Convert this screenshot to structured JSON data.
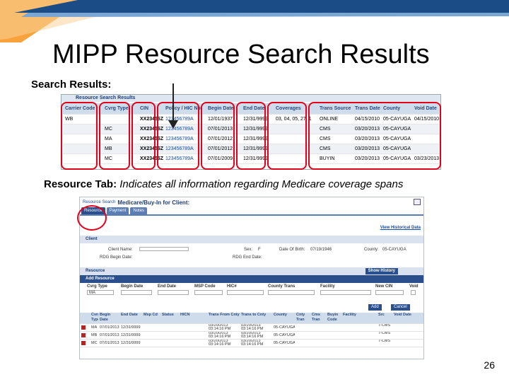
{
  "slide": {
    "title": "MIPP Resource Search Results",
    "subhead": "Search Results:",
    "desc_bold": "Resource Tab:",
    "desc_italic": "Indicates all information regarding Medicare coverage spans",
    "page_number": "26"
  },
  "search_grid": {
    "caption": "Resource Search Results",
    "headers": [
      "Carrier Code",
      "Cvrg Type",
      "CIN",
      "Policy / HIC No",
      "Begin Date",
      "End Date",
      "Coverages",
      "Trans Source",
      "Trans Date",
      "County",
      "Void Date"
    ],
    "rows": [
      [
        "WB",
        "",
        "XX23456Z",
        "123456789A",
        "12/01/1937",
        "12/31/9999",
        "03, 04, 05, 27, 1",
        "ONLINE",
        "04/15/2010",
        "05-CAYUGA",
        "04/15/2010"
      ],
      [
        "",
        "MC",
        "XX23456Z",
        "123456789A",
        "07/01/2013",
        "12/31/9999",
        "",
        "CMS",
        "03/20/2013",
        "05-CAYUGA",
        ""
      ],
      [
        "",
        "MA",
        "XX23456Z",
        "123456789A",
        "07/01/2012",
        "12/31/9999",
        "",
        "CMS",
        "03/20/2013",
        "05-CAYUGA",
        ""
      ],
      [
        "",
        "MB",
        "XX23456Z",
        "123456789A",
        "07/01/2012",
        "12/31/9999",
        "",
        "CMS",
        "03/20/2013",
        "05-CAYUGA",
        ""
      ],
      [
        "",
        "MC",
        "XX23456Z",
        "123456789A",
        "07/01/2009",
        "12/31/9999",
        "",
        "BUYIN",
        "03/20/2013",
        "05-CAYUGA",
        "03/23/2013"
      ]
    ]
  },
  "buyin": {
    "crumb": "Resource Search",
    "page_title": "Medicare/Buy-In for Client:",
    "tabs": [
      "Resource",
      "Payment",
      "Notes"
    ],
    "view_history": "View Historical Data",
    "client_bar": "Client",
    "client_name_label": "Client Name:",
    "sex_label": "Sex:",
    "sex_value": "F",
    "dob_label": "Date Of Birth:",
    "dob_value": "07/19/1946",
    "county_label": "County:",
    "county_value": "05-CAYUGA",
    "rdg_begin_label": "RDG Begin Date:",
    "rdg_end_label": "RDG End Date:",
    "resource_bar": "Resource",
    "show_history": "Show History",
    "add_bar": "Add Resource",
    "add_labels": [
      "Cvrg Type",
      "Begin Date",
      "End Date",
      "MSP Code",
      "HIC#",
      "County Trans",
      "Facility",
      "New CIN",
      "Void"
    ],
    "cvrg_default": "MA",
    "add_button": "Add",
    "cancel_button": "Cancel",
    "grid_headers": [
      "Cvrg Type",
      "Begin Date",
      "End Date",
      "Msp Cd",
      "Status",
      "HICN",
      "Trans From Cnty",
      "Trans to Cnty",
      "County",
      "Cnty Tran",
      "Cms Tran",
      "Buyin Code",
      "Facility",
      "Src",
      "Void Date"
    ],
    "grid_rows": [
      [
        "MA",
        "07/01/2013",
        "12/31/9999",
        "",
        "",
        "",
        "03/20/2013 03:14:16 PM",
        "03/20/2013 03:14:16 PM",
        "05-CAYUGA",
        "",
        "",
        "",
        "",
        "7-CMS",
        ""
      ],
      [
        "MB",
        "07/01/2013",
        "12/31/9999",
        "",
        "",
        "",
        "03/20/2013 03:14:16 PM",
        "03/20/2013 03:14:16 PM",
        "05-CAYUGA",
        "",
        "",
        "",
        "",
        "7-CMS",
        ""
      ],
      [
        "MC",
        "07/01/2013",
        "12/31/9999",
        "",
        "",
        "",
        "03/20/2013 03:14:16 PM",
        "03/20/2013 03:14:16 PM",
        "05-CAYUGA",
        "",
        "",
        "",
        "",
        "7-CMS",
        ""
      ]
    ]
  },
  "colors": {
    "highlight": "#e2001a",
    "accent_blue": "#2b4f8c",
    "deco_orange": "#f7a23b",
    "deco_blue": "#1b4c86"
  }
}
